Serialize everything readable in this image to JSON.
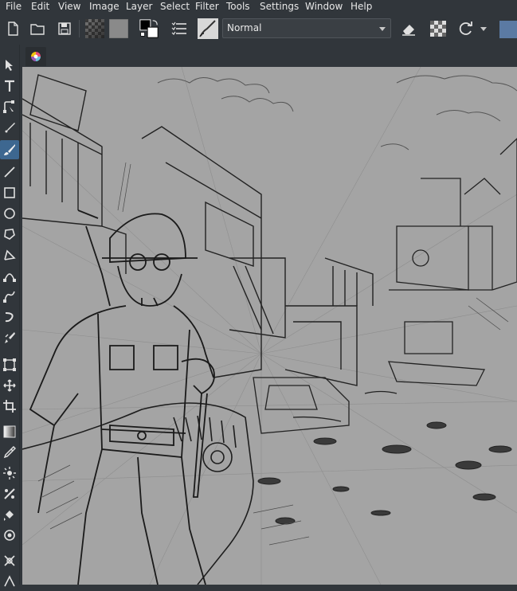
{
  "menu": {
    "items": [
      "File",
      "Edit",
      "View",
      "Image",
      "Layer",
      "Select",
      "Filter",
      "Tools",
      "Settings",
      "Window",
      "Help"
    ]
  },
  "toolbar": {
    "blend_mode": "Normal",
    "buttons": [
      "new-document-icon",
      "open-folder-icon",
      "save-icon",
      "pattern-preset-icon",
      "gradient-preset-icon",
      "color-swap-icon",
      "brush-settings-icon",
      "brush-preset-icon",
      "eraser-icon",
      "alpha-lock-icon",
      "reload-preset-icon",
      "more-arrow-icon"
    ]
  },
  "tools": [
    "select-shapes-icon",
    "text-tool-icon",
    "edit-shapes-icon",
    "calligraphy-icon",
    "freehand-brush-icon",
    "line-tool-icon",
    "rectangle-tool-icon",
    "ellipse-tool-icon",
    "polygon-tool-icon",
    "polyline-tool-icon",
    "bezier-tool-icon",
    "freehand-path-icon",
    "dynamic-brush-icon",
    "multibrush-icon",
    "transform-icon",
    "move-icon",
    "crop-icon",
    "gradient-icon",
    "color-picker-icon",
    "smart-patch-icon",
    "assistant-tool-icon",
    "fill-icon",
    "reference-icon",
    "measure-icon"
  ],
  "colors": {
    "ui_background": "#31363b",
    "active_tool": "#3d6790",
    "canvas": "#a4a4a4",
    "ink": "#1e1e1e"
  },
  "document": {
    "tab_icon": "krita-document-icon"
  }
}
